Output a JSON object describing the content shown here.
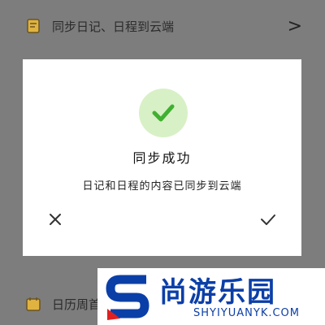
{
  "background_rows": {
    "sync": {
      "icon": "notebook-icon",
      "label": "同步日记、日程到云端",
      "arrow": ">"
    },
    "calendar": {
      "icon": "calendar-week-icon",
      "label": "日历周首"
    }
  },
  "dialog": {
    "icon": "success-check-icon",
    "title": "同步成功",
    "message": "日记和日程的内容已同步到云端",
    "close_icon": "close-icon",
    "confirm_icon": "checkmark-icon"
  },
  "watermark": {
    "logo": "s-logo-icon",
    "name": "尚游乐园",
    "domain": "SHYIYUANYK.COM"
  },
  "colors": {
    "overlay": "#7d7d7d",
    "success_bg": "#d8f0c6",
    "success_check": "#3fb02f",
    "watermark_blue": "#0b3fa8",
    "watermark_red": "#e02020"
  }
}
